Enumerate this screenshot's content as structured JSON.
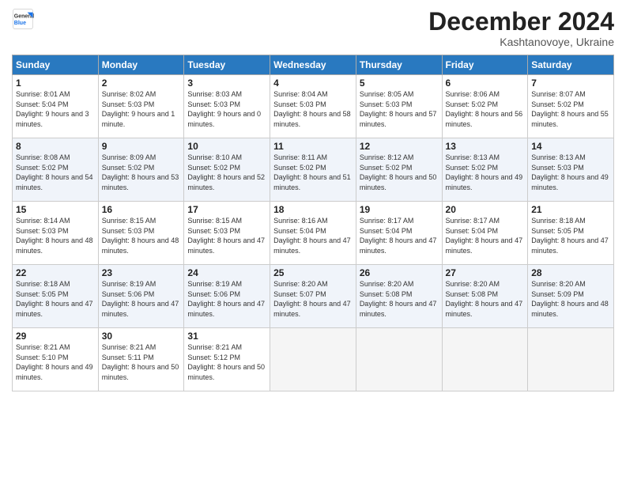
{
  "logo": {
    "line1": "General",
    "line2": "Blue"
  },
  "title": "December 2024",
  "subtitle": "Kashtanovoye, Ukraine",
  "weekdays": [
    "Sunday",
    "Monday",
    "Tuesday",
    "Wednesday",
    "Thursday",
    "Friday",
    "Saturday"
  ],
  "weeks": [
    [
      {
        "day": "1",
        "sunrise": "8:01 AM",
        "sunset": "5:04 PM",
        "daylight": "9 hours and 3 minutes."
      },
      {
        "day": "2",
        "sunrise": "8:02 AM",
        "sunset": "5:03 PM",
        "daylight": "9 hours and 1 minute."
      },
      {
        "day": "3",
        "sunrise": "8:03 AM",
        "sunset": "5:03 PM",
        "daylight": "9 hours and 0 minutes."
      },
      {
        "day": "4",
        "sunrise": "8:04 AM",
        "sunset": "5:03 PM",
        "daylight": "8 hours and 58 minutes."
      },
      {
        "day": "5",
        "sunrise": "8:05 AM",
        "sunset": "5:03 PM",
        "daylight": "8 hours and 57 minutes."
      },
      {
        "day": "6",
        "sunrise": "8:06 AM",
        "sunset": "5:02 PM",
        "daylight": "8 hours and 56 minutes."
      },
      {
        "day": "7",
        "sunrise": "8:07 AM",
        "sunset": "5:02 PM",
        "daylight": "8 hours and 55 minutes."
      }
    ],
    [
      {
        "day": "8",
        "sunrise": "8:08 AM",
        "sunset": "5:02 PM",
        "daylight": "8 hours and 54 minutes."
      },
      {
        "day": "9",
        "sunrise": "8:09 AM",
        "sunset": "5:02 PM",
        "daylight": "8 hours and 53 minutes."
      },
      {
        "day": "10",
        "sunrise": "8:10 AM",
        "sunset": "5:02 PM",
        "daylight": "8 hours and 52 minutes."
      },
      {
        "day": "11",
        "sunrise": "8:11 AM",
        "sunset": "5:02 PM",
        "daylight": "8 hours and 51 minutes."
      },
      {
        "day": "12",
        "sunrise": "8:12 AM",
        "sunset": "5:02 PM",
        "daylight": "8 hours and 50 minutes."
      },
      {
        "day": "13",
        "sunrise": "8:13 AM",
        "sunset": "5:02 PM",
        "daylight": "8 hours and 49 minutes."
      },
      {
        "day": "14",
        "sunrise": "8:13 AM",
        "sunset": "5:03 PM",
        "daylight": "8 hours and 49 minutes."
      }
    ],
    [
      {
        "day": "15",
        "sunrise": "8:14 AM",
        "sunset": "5:03 PM",
        "daylight": "8 hours and 48 minutes."
      },
      {
        "day": "16",
        "sunrise": "8:15 AM",
        "sunset": "5:03 PM",
        "daylight": "8 hours and 48 minutes."
      },
      {
        "day": "17",
        "sunrise": "8:15 AM",
        "sunset": "5:03 PM",
        "daylight": "8 hours and 47 minutes."
      },
      {
        "day": "18",
        "sunrise": "8:16 AM",
        "sunset": "5:04 PM",
        "daylight": "8 hours and 47 minutes."
      },
      {
        "day": "19",
        "sunrise": "8:17 AM",
        "sunset": "5:04 PM",
        "daylight": "8 hours and 47 minutes."
      },
      {
        "day": "20",
        "sunrise": "8:17 AM",
        "sunset": "5:04 PM",
        "daylight": "8 hours and 47 minutes."
      },
      {
        "day": "21",
        "sunrise": "8:18 AM",
        "sunset": "5:05 PM",
        "daylight": "8 hours and 47 minutes."
      }
    ],
    [
      {
        "day": "22",
        "sunrise": "8:18 AM",
        "sunset": "5:05 PM",
        "daylight": "8 hours and 47 minutes."
      },
      {
        "day": "23",
        "sunrise": "8:19 AM",
        "sunset": "5:06 PM",
        "daylight": "8 hours and 47 minutes."
      },
      {
        "day": "24",
        "sunrise": "8:19 AM",
        "sunset": "5:06 PM",
        "daylight": "8 hours and 47 minutes."
      },
      {
        "day": "25",
        "sunrise": "8:20 AM",
        "sunset": "5:07 PM",
        "daylight": "8 hours and 47 minutes."
      },
      {
        "day": "26",
        "sunrise": "8:20 AM",
        "sunset": "5:08 PM",
        "daylight": "8 hours and 47 minutes."
      },
      {
        "day": "27",
        "sunrise": "8:20 AM",
        "sunset": "5:08 PM",
        "daylight": "8 hours and 47 minutes."
      },
      {
        "day": "28",
        "sunrise": "8:20 AM",
        "sunset": "5:09 PM",
        "daylight": "8 hours and 48 minutes."
      }
    ],
    [
      {
        "day": "29",
        "sunrise": "8:21 AM",
        "sunset": "5:10 PM",
        "daylight": "8 hours and 49 minutes."
      },
      {
        "day": "30",
        "sunrise": "8:21 AM",
        "sunset": "5:11 PM",
        "daylight": "8 hours and 50 minutes."
      },
      {
        "day": "31",
        "sunrise": "8:21 AM",
        "sunset": "5:12 PM",
        "daylight": "8 hours and 50 minutes."
      },
      null,
      null,
      null,
      null
    ]
  ]
}
